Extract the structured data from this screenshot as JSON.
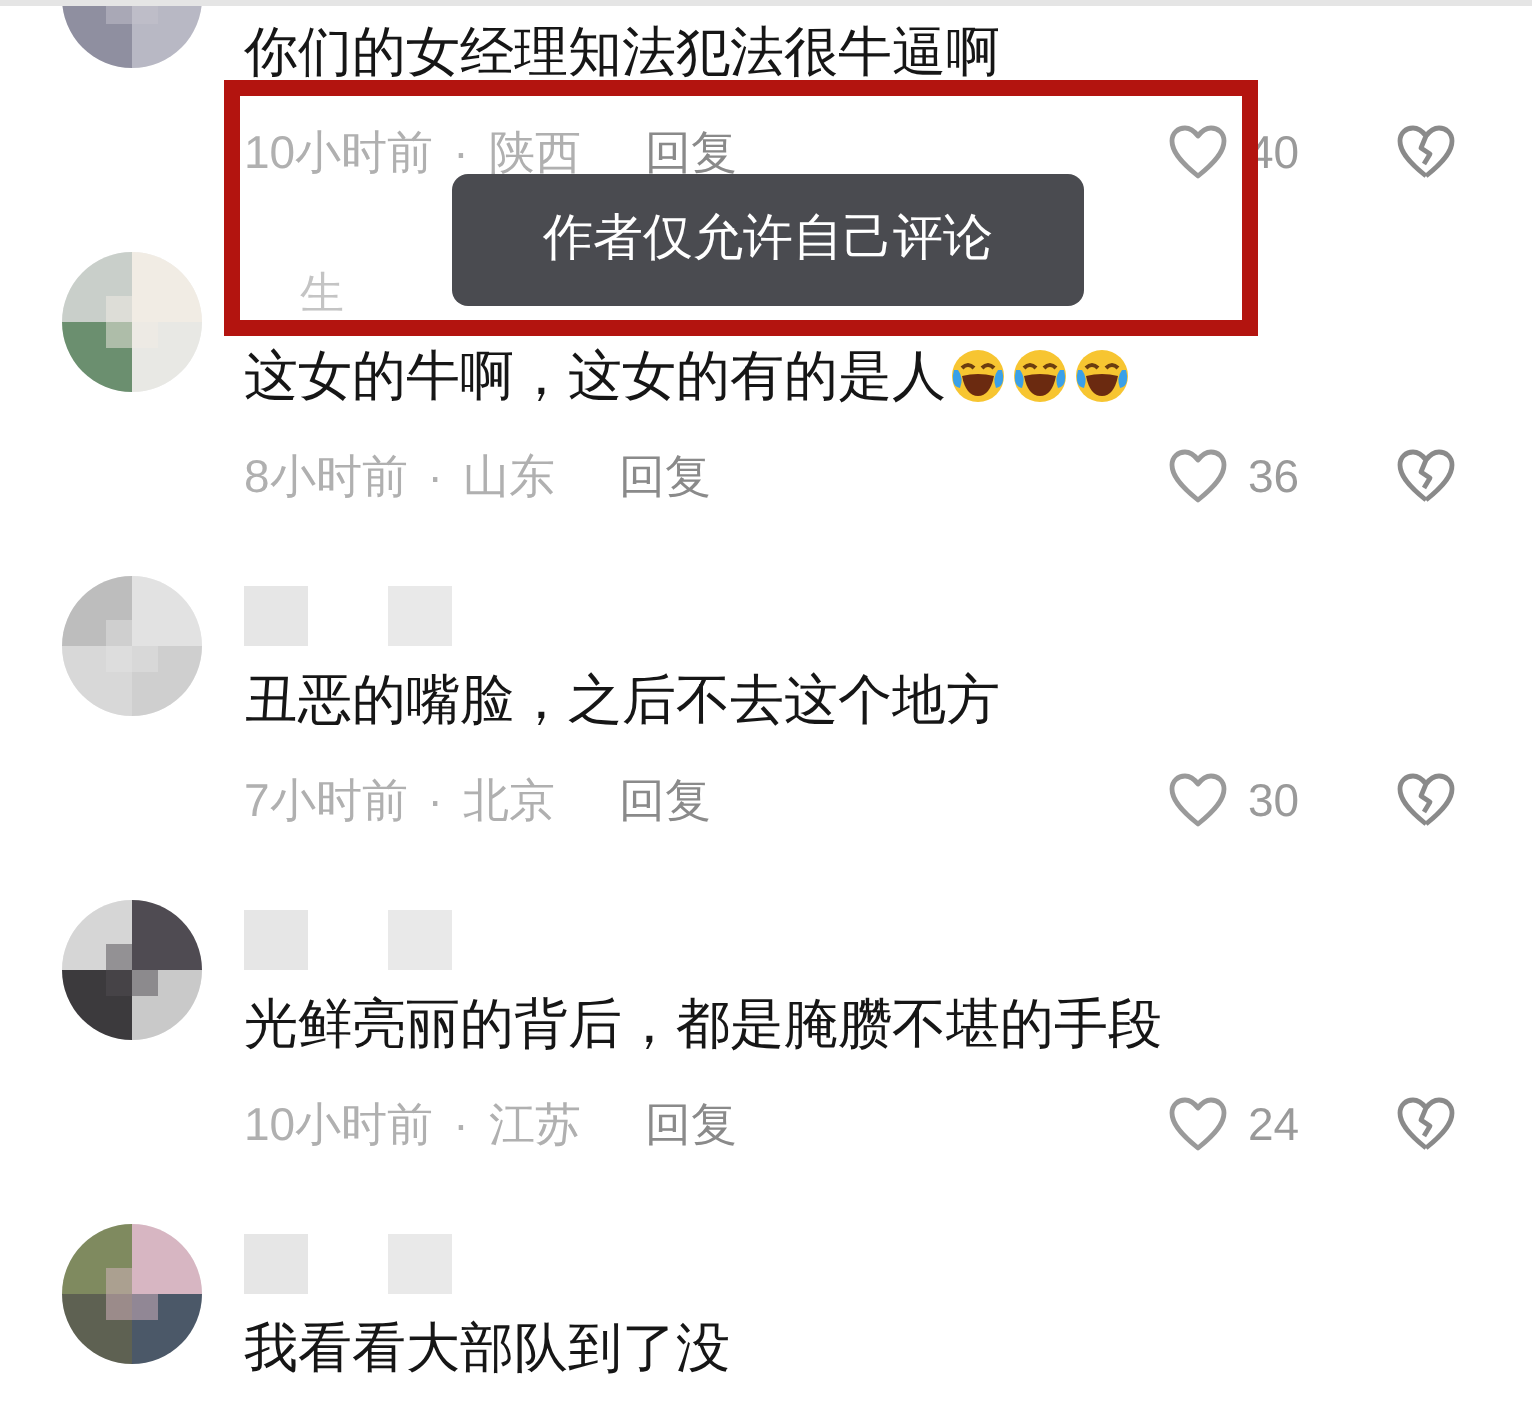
{
  "comments": [
    {
      "text": "你们的女经理知法犯法很牛逼啊",
      "time": "10小时前",
      "separator": "·",
      "location": "陕西",
      "reply": "回复",
      "likes": "40",
      "author_hidden": false
    },
    {
      "author": "生",
      "text": "这女的牛啊，这女的有的是人",
      "trailing_icons": [
        {
          "kind": "laughing-crying"
        },
        {
          "kind": "laughing-crying"
        },
        {
          "kind": "laughing-crying"
        }
      ],
      "time": "8小时前",
      "separator": "·",
      "location": "山东",
      "reply": "回复",
      "likes": "36",
      "author_hidden": false
    },
    {
      "text": "丑恶的嘴脸，之后不去这个地方",
      "time": "7小时前",
      "separator": "·",
      "location": "北京",
      "reply": "回复",
      "likes": "30",
      "author_hidden": true
    },
    {
      "text": "光鲜亮丽的背后，都是腌臜不堪的手段",
      "time": "10小时前",
      "separator": "·",
      "location": "江苏",
      "reply": "回复",
      "likes": "24",
      "author_hidden": true
    },
    {
      "text": "我看看大部队到了没",
      "author_hidden": true
    }
  ],
  "highlight_box": {
    "color": "#b3140f"
  },
  "toast": {
    "text": "作者仅允许自己评论"
  }
}
